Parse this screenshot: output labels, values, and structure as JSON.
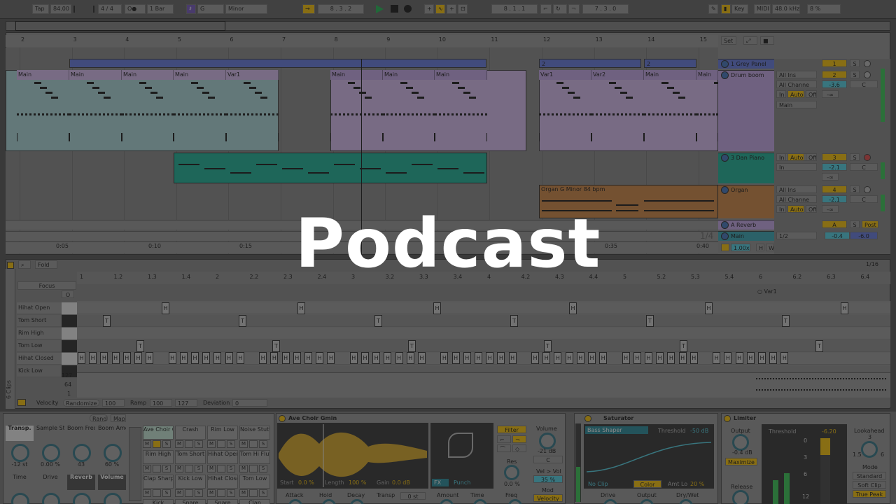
{
  "transport": {
    "tap": "Tap",
    "tempo": "84.00",
    "time_sig": "4 / 4",
    "metronome": "1 Bar",
    "key_root": "G",
    "scale": "Minor",
    "arrangement_pos": "8 .   3 .   2",
    "loop_start": "8 .   1 .   1",
    "loop_length": "7 .   3 .   0",
    "key_label": "Key",
    "midi_label": "MIDI",
    "sample_rate": "48.0 kHz",
    "cpu": "8 %"
  },
  "arrangement": {
    "bar_numbers": [
      "2",
      "3",
      "4",
      "5",
      "6",
      "7",
      "8",
      "9",
      "10",
      "11",
      "12",
      "13",
      "14",
      "15"
    ],
    "set_label": "Set",
    "time_labels": [
      "0:05",
      "0:10",
      "0:15",
      "0:35",
      "0:40"
    ],
    "fraction": "1/4",
    "locators": [
      "2",
      "2"
    ],
    "drum_clips": [
      "Main",
      "Main",
      "Main",
      "Main",
      "Var1",
      "Main",
      "Main",
      "Main",
      "Main",
      "Var1",
      "Var2",
      "Main",
      "Main"
    ],
    "organ_clip": "Organ G Minor 84 bpm"
  },
  "tracks": [
    {
      "name": "1 Grey Panel",
      "number": "1",
      "input": "",
      "channel": "",
      "volume": "",
      "pan": "",
      "color": "#5b6fd0"
    },
    {
      "name": "Drum boom",
      "number": "2",
      "input": "All Ins",
      "channel": "All Channe",
      "volume": "-3.6",
      "pan": "C",
      "route": "Main",
      "inf": "-∞",
      "color": "#b79ad8"
    },
    {
      "name": "3 Dan Piano",
      "number": "3",
      "input": "In",
      "channel": "Main",
      "volume": "-2.1",
      "pan": "C",
      "inf": "-∞",
      "color": "#14a58a"
    },
    {
      "name": "Organ",
      "number": "4",
      "input": "All Ins",
      "channel": "All Channe",
      "volume": "-2.1",
      "pan": "C",
      "inf": "-∞",
      "color": "#c07a3a"
    },
    {
      "name": "A Reverb",
      "number": "A",
      "post": "Post",
      "color": "#b79ad8"
    },
    {
      "name": "Main",
      "number": "",
      "route": "1/2",
      "volume": "-0.4",
      "pan": "-6.0",
      "color": "#2e9aa8"
    }
  ],
  "mixer_labels": {
    "in": "In",
    "auto": "Auto",
    "off": "Off",
    "s": "S",
    "zoom": "1.00x",
    "h": "H",
    "w": "W"
  },
  "clip_editor": {
    "fold": "Fold",
    "focus": "Focus",
    "grid": "1/16",
    "beat_labels": [
      "1",
      "1.2",
      "1.3",
      "1.4",
      "2",
      "2.2",
      "2.3",
      "2.4",
      "3",
      "3.2",
      "3.3",
      "3.4",
      "4",
      "4.2",
      "4.3",
      "4.4",
      "5",
      "5.2",
      "5.3",
      "5.4",
      "6",
      "6.2",
      "6.3",
      "6.4"
    ],
    "var_label": "Var1",
    "drum_rows": [
      "Hihat Open",
      "Tom Short",
      "Rim High",
      "Tom Low",
      "Hihat Closed",
      "Kick Low"
    ],
    "note_letters": {
      "h": "H",
      "t": "T"
    },
    "velocity_scale": [
      "127",
      "64",
      "1"
    ],
    "velocity_label": "Velocity",
    "randomize": "Randomize",
    "velocity_value": "100",
    "ramp": "Ramp",
    "ramp_from": "100",
    "ramp_to": "127",
    "deviation": "Deviation",
    "deviation_value": "0",
    "clips_count": "6 Clips"
  },
  "drum_rack": {
    "rand": "Rand",
    "map": "Map",
    "macros": [
      {
        "label": "Transp.",
        "value": "-12 st"
      },
      {
        "label": "Sample Start",
        "value": "0.00 %"
      },
      {
        "label": "Boom Freq",
        "value": "43"
      },
      {
        "label": "Boom Amount",
        "value": "60 %"
      },
      {
        "label": "Time",
        "value": ""
      },
      {
        "label": "Drive",
        "value": ""
      },
      {
        "label": "Reverb",
        "value": ""
      },
      {
        "label": "Volume",
        "value": ""
      }
    ],
    "pads": [
      "Ave Choir Gmin",
      "Crash",
      "Rim Low",
      "Noise Stutter",
      "Rim High",
      "Tom Short",
      "Hihat Open",
      "Tom Hi Flutter",
      "Clap Sharp",
      "Kick Low",
      "Hihat Closed",
      "Tom Low",
      "Kick",
      "Snare",
      "Snare",
      "Clap"
    ],
    "pad_buttons": {
      "m": "M",
      "s": "S"
    }
  },
  "simpler": {
    "title": "Ave Choir Gmin",
    "start_label": "Start",
    "start": "0.0 %",
    "length_label": "Length",
    "length": "100 %",
    "gain_label": "Gain",
    "gain": "0.0 dB",
    "fx": "FX",
    "fx_mode": "Punch",
    "filter": "Filter",
    "volume_label": "Volume",
    "volume": "-21 dB",
    "pan": "C",
    "res_label": "Res",
    "res": "0.0 %",
    "vel_vol_label": "Vel > Vol",
    "vel_vol": "35 %",
    "mod": "Mod",
    "velocity": "Velocity",
    "bottom_labels": [
      "Attack",
      "Hold",
      "Decay",
      "Transp",
      "Amount",
      "Time",
      "Freq"
    ],
    "transp_value": "0 st"
  },
  "saturator": {
    "title": "Saturator",
    "shaper": "Bass Shaper",
    "threshold_label": "Threshold",
    "threshold": "-50 dB",
    "no_clip": "No Clip",
    "color": "Color",
    "amt_label": "Amt Lo",
    "amt": "20 %",
    "bottom_labels": [
      "Drive",
      "Output",
      "Dry/Wet"
    ]
  },
  "limiter": {
    "title": "Limiter",
    "output_label": "Output",
    "output": "-0.4 dB",
    "maximize": "Maximize",
    "threshold_label": "Threshold",
    "threshold_value": "-6.20",
    "scale": [
      "0",
      "3",
      "6",
      "12"
    ],
    "lookahead_label": "Lookahead",
    "lookahead": "3",
    "lk_min": "1.5",
    "lk_max": "6",
    "mode_label": "Mode",
    "mode_standard": "Standard",
    "mode_softclip": "Soft Clip",
    "mode_truepeak": "True Peak",
    "release_label": "Release"
  },
  "overlay": {
    "title": "Podcast"
  },
  "colors": {
    "accent": "#e8b400",
    "teal": "#1aa88f",
    "lilac": "#b79ad8",
    "orange": "#c07a3a",
    "blue": "#5b6fd0"
  }
}
